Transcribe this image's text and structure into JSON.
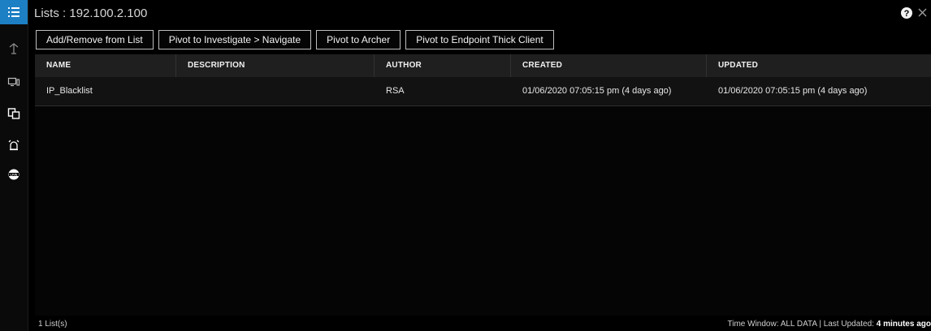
{
  "title": {
    "label": "Lists",
    "separator": " : ",
    "ip": "192.100.2.100"
  },
  "toolbar": {
    "add_remove": "Add/Remove from List",
    "pivot_investigate": "Pivot to Investigate > Navigate",
    "pivot_archer": "Pivot to Archer",
    "pivot_endpoint": "Pivot to Endpoint Thick Client"
  },
  "table": {
    "columns": [
      "NAME",
      "DESCRIPTION",
      "AUTHOR",
      "CREATED",
      "UPDATED"
    ],
    "rows": [
      {
        "name": "IP_Blacklist",
        "description": "",
        "author": "RSA",
        "created": "01/06/2020 07:05:15 pm (4 days ago)",
        "updated": "01/06/2020 07:05:15 pm (4 days ago)"
      }
    ]
  },
  "status": {
    "count": "1 List(s)",
    "time_window": "Time Window: ALL DATA | Last Updated:",
    "last_updated": "4 minutes ago"
  },
  "sidebar": {
    "icons": [
      "list-icon",
      "pin-icon",
      "devices-icon",
      "file-icon",
      "alarm-icon",
      "live-icon"
    ]
  },
  "colors": {
    "accent": "#1d7fc4",
    "background": "#000000",
    "header": "#1f1f1f"
  }
}
